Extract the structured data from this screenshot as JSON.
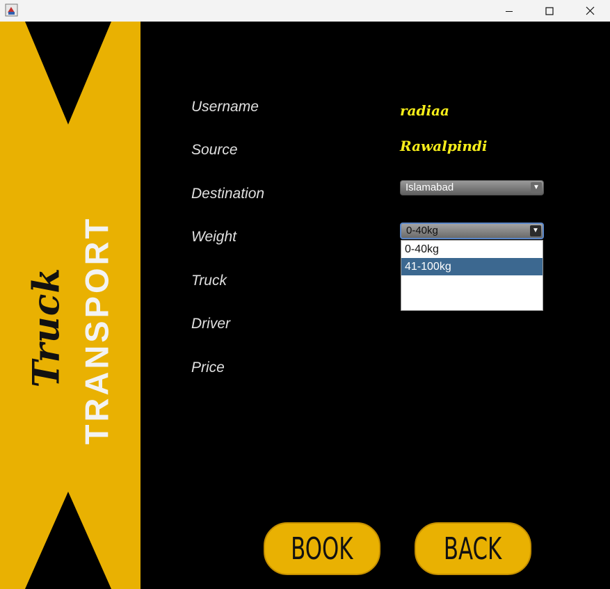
{
  "window": {
    "controls": {
      "minimize": "minimize-icon",
      "maximize": "maximize-icon",
      "close": "close-icon"
    }
  },
  "banner": {
    "logo_word": "Truck",
    "logo_subtitle": "TRANSPORT",
    "colors": {
      "banner": "#e9b102",
      "triangles": "#000000"
    }
  },
  "form": {
    "labels": {
      "username": "Username",
      "source": "Source",
      "destination": "Destination",
      "weight": "Weight",
      "truck": "Truck",
      "driver": "Driver",
      "price": "Price"
    },
    "values": {
      "username": "radiaa",
      "source": "Rawalpindi"
    },
    "destination_select": {
      "selected": "Islamabad"
    },
    "weight_select": {
      "selected": "0-40kg",
      "options": [
        "0-40kg",
        "41-100kg"
      ],
      "highlighted_option": "41-100kg"
    },
    "colors": {
      "value_text": "#f7ee1a",
      "label_text": "#e0e0e0",
      "highlight": "#3c6890"
    }
  },
  "actions": {
    "book_label": "BOOK",
    "back_label": "BACK"
  }
}
